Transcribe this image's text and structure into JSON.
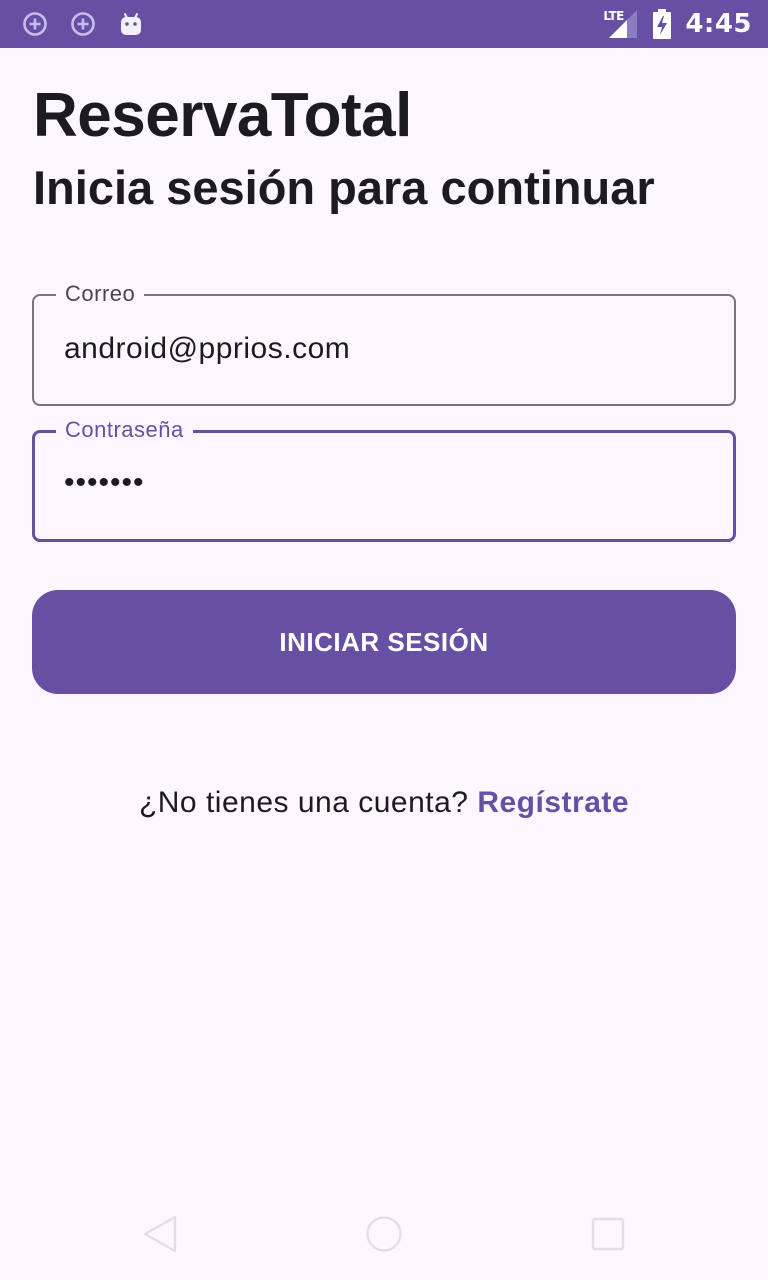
{
  "status_bar": {
    "time": "4:45",
    "network": "LTE",
    "left_icons": [
      "add-circle-icon",
      "add-circle-icon",
      "android-icon"
    ],
    "background": "#6750A4"
  },
  "header": {
    "app_title": "ReservaTotal",
    "subtitle": "Inicia sesión para continuar"
  },
  "form": {
    "email": {
      "label": "Correo",
      "value": "android@pprios.com"
    },
    "password": {
      "label": "Contraseña",
      "value": "•••••••"
    },
    "submit_label": "INICIAR SESIÓN"
  },
  "register": {
    "prompt": "¿No tienes una cuenta?",
    "link_label": "Regístrate"
  },
  "nav_bar": {
    "buttons": [
      "back-icon",
      "home-icon",
      "recents-icon"
    ]
  },
  "colors": {
    "primary": "#6750A4",
    "background": "#FEF7FF",
    "text": "#1D1B20",
    "outline": "#79747E"
  }
}
